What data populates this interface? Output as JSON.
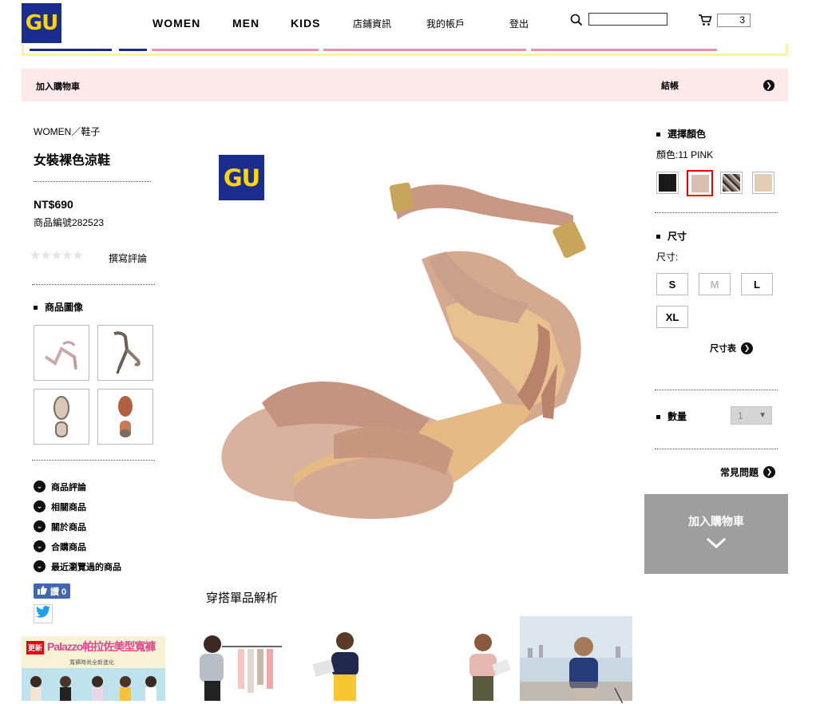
{
  "header": {
    "logo": "GU",
    "nav": [
      "WOMEN",
      "MEN",
      "KIDS",
      "店鋪資訊",
      "我的帳戶",
      "登出"
    ],
    "cart_count": "3",
    "search_placeholder": ""
  },
  "cart_bar": {
    "add_label": "加入購物車",
    "checkout_label": "結帳"
  },
  "product": {
    "breadcrumb": "WOMEN／鞋子",
    "title": "女裝裸色涼鞋",
    "price": "NT$690",
    "code": "商品編號282523",
    "rating": 0,
    "review_link": "撰寫評論",
    "images_heading": "商品圖像",
    "badge": "GU"
  },
  "side_links": [
    "商品評論",
    "相關商品",
    "關於商品",
    "合購商品",
    "最近瀏覽過的商品"
  ],
  "social": {
    "like_label": "讚 0"
  },
  "options": {
    "color_heading": "選擇顏色",
    "color_label": "顏色:11 PINK",
    "swatches": [
      {
        "name": "black",
        "color": "#1a1a1a"
      },
      {
        "name": "pink",
        "color": "#d9bfb1"
      },
      {
        "name": "python",
        "color": "#6b6057"
      },
      {
        "name": "beige",
        "color": "#e3cdb4"
      }
    ],
    "size_heading": "尺寸",
    "size_label": "尺寸:",
    "sizes": [
      {
        "label": "S",
        "available": true
      },
      {
        "label": "M",
        "available": false
      },
      {
        "label": "L",
        "available": true
      },
      {
        "label": "XL",
        "available": true
      }
    ],
    "size_chart": "尺寸表",
    "qty_heading": "數量",
    "qty_value": "1",
    "faq": "常見問題",
    "add_to_cart": "加入購物車"
  },
  "styling": {
    "heading": "穿搭單品解析"
  },
  "banner": {
    "badge": "更新",
    "title": "Palazzo帕拉佐美型寬褲",
    "subtitle": "寬褲時尚全新進化"
  },
  "colors": {
    "brand": "#1a2d8f",
    "brand_text": "#ffd600",
    "cart_bar_bg": "#fde9ea",
    "cta_bg": "#9e9e9e",
    "swatch_selected": "#e00000"
  }
}
